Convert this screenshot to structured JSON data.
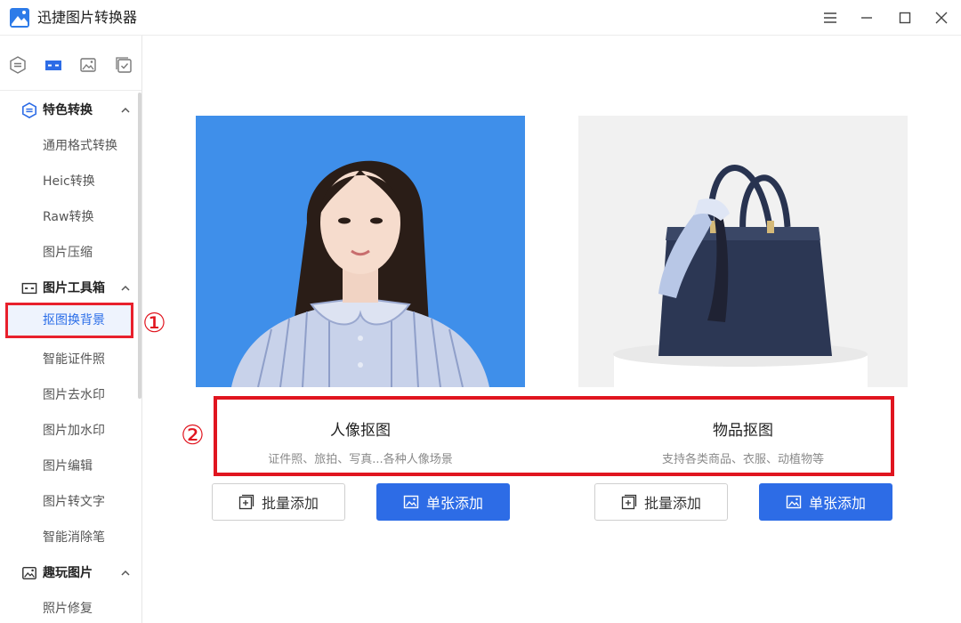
{
  "window": {
    "title": "迅捷图片转换器",
    "controls": [
      "menu-icon",
      "minimize-icon",
      "maximize-icon",
      "close-icon"
    ]
  },
  "sidebar": {
    "mode_tabs": [
      "convert-icon",
      "toolbox-icon",
      "image-play-icon",
      "checklist-icon"
    ],
    "groups": [
      {
        "label": "特色转换",
        "icon": "convert-icon",
        "expanded": true,
        "items": [
          "通用格式转换",
          "Heic转换",
          "Raw转换",
          "图片压缩"
        ]
      },
      {
        "label": "图片工具箱",
        "icon": "toolbox-icon",
        "expanded": true,
        "items": [
          "抠图换背景",
          "智能证件照",
          "图片去水印",
          "图片加水印",
          "图片编辑",
          "图片转文字",
          "智能消除笔"
        ]
      },
      {
        "label": "趣玩图片",
        "icon": "image-play-icon",
        "expanded": true,
        "items": [
          "照片修复"
        ]
      }
    ],
    "active_item": "抠图换背景"
  },
  "annotations": {
    "marker_1": "①",
    "marker_2": "②"
  },
  "cards": [
    {
      "title": "人像抠图",
      "subtitle": "证件照、旅拍、写真...各种人像场景",
      "batch_label": "批量添加",
      "single_label": "单张添加"
    },
    {
      "title": "物品抠图",
      "subtitle": "支持各类商品、衣服、动植物等",
      "batch_label": "批量添加",
      "single_label": "单张添加"
    }
  ],
  "colors": {
    "accent": "#2d6ce6",
    "annotation_red": "#e0151f",
    "portrait_bg": "#3f8fea"
  }
}
